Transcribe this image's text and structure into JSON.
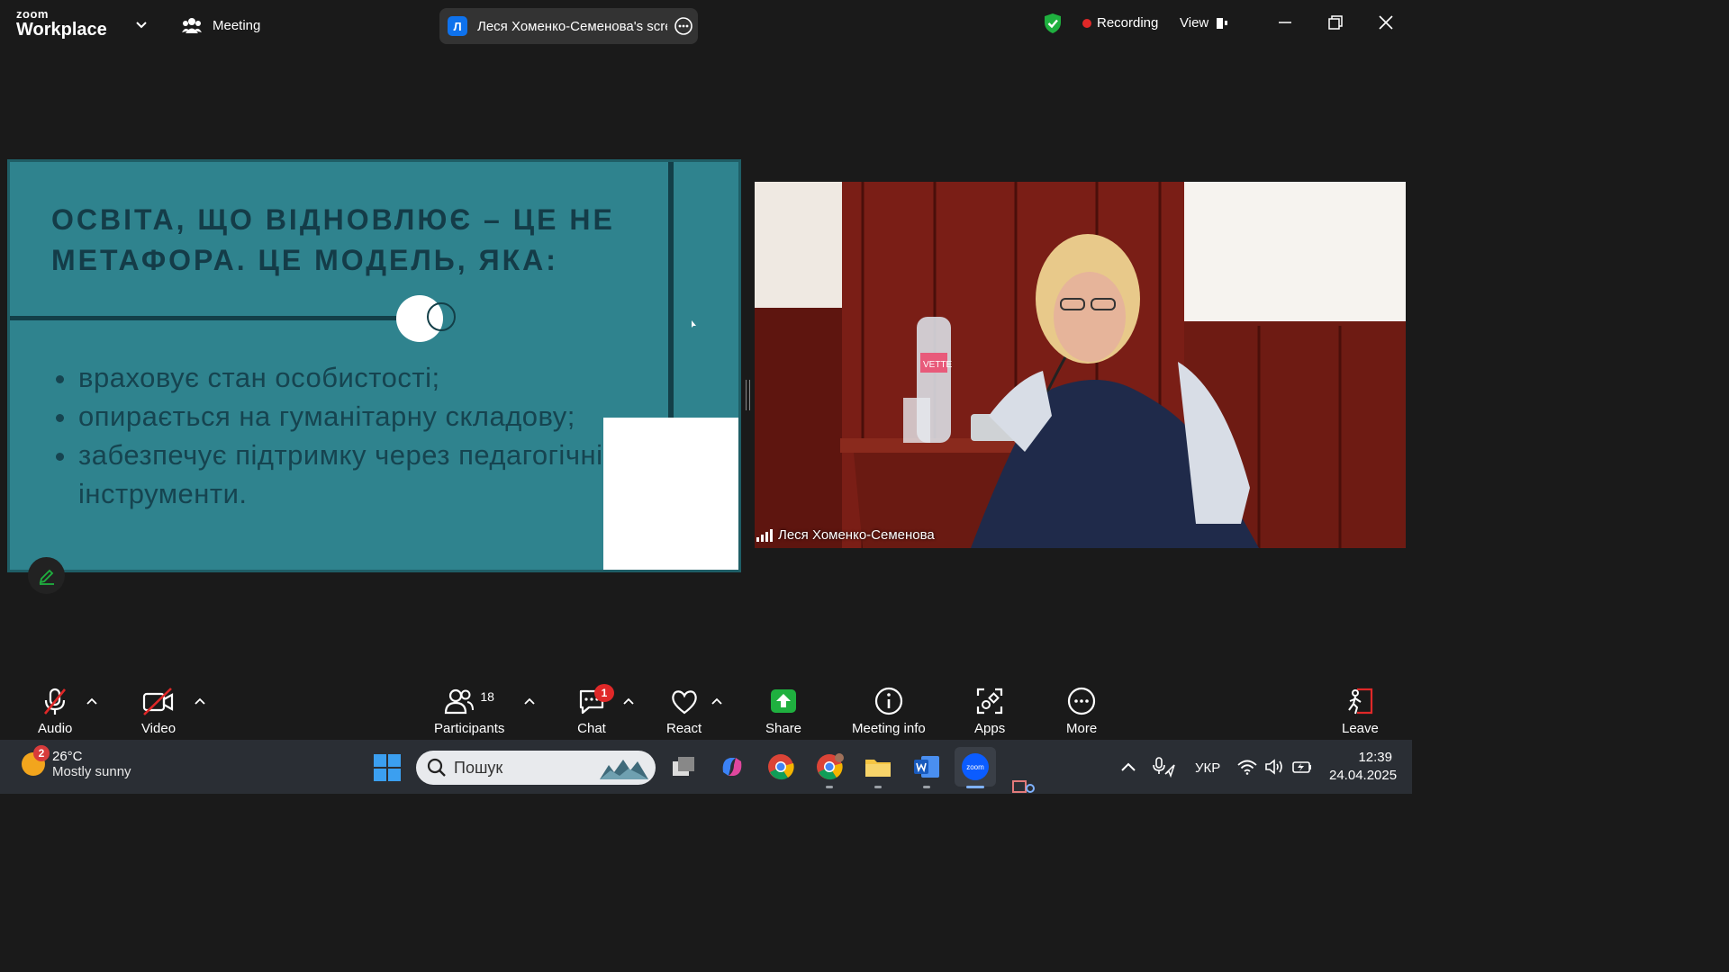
{
  "titlebar": {
    "brand_top": "zoom",
    "brand_bottom": "Workplace",
    "meeting_label": "Meeting",
    "screen_share_badge": "Л",
    "screen_share_label": "Леся Хоменко-Семенова's scree",
    "recording_label": "Recording",
    "view_label": "View",
    "icons": [
      "chevron-down-icon",
      "people-icon",
      "more-icon",
      "shield-check-icon",
      "view-icon",
      "minimize-icon",
      "restore-icon",
      "close-icon"
    ]
  },
  "slide": {
    "heading_line1": "ОСВІТА, ЩО ВІДНОВЛЮЄ – ЦЕ НЕ",
    "heading_line2": "МЕТАФОРА. ЦЕ МОДЕЛЬ, ЯКА:",
    "bullets": [
      "враховує стан особистості;",
      "опирається на гуманітарну складову;",
      "забезпечує підтримку через педагогічні інструменти."
    ],
    "colors": {
      "background": "#2f838e",
      "text": "#164450",
      "accent": "#133f48"
    }
  },
  "video": {
    "participant_name": "Леся Хоменко-Семенова",
    "bottle_label": "VETTE"
  },
  "toolbar": {
    "audio": "Audio",
    "video": "Video",
    "participants": "Participants",
    "participants_count": "18",
    "chat": "Chat",
    "chat_badge": "1",
    "react": "React",
    "share": "Share",
    "meeting_info": "Meeting info",
    "apps": "Apps",
    "more": "More",
    "leave": "Leave",
    "colors": {
      "share_green": "#1fb03f",
      "muted_red": "#e02828"
    }
  },
  "taskbar": {
    "weather_temp": "26°C",
    "weather_desc": "Mostly sunny",
    "weather_alert_count": "2",
    "search_placeholder": "Пошук",
    "language": "УКР",
    "time": "12:39",
    "date": "24.04.2025"
  }
}
